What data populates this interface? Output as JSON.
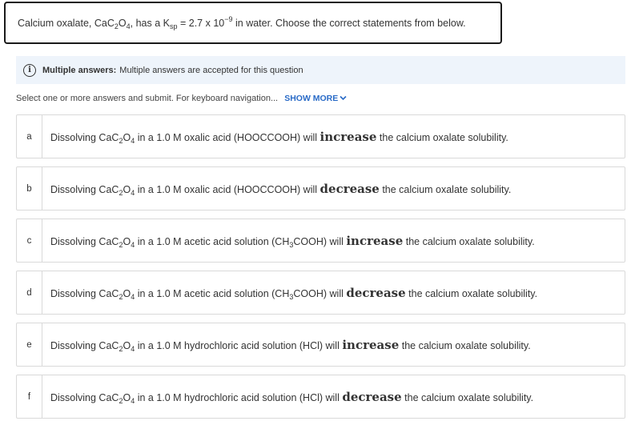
{
  "question": {
    "prefix": "Calcium oxalate, CaC",
    "sub1": "2",
    "mid1": "O",
    "sub2": "4",
    "mid2": ", has a K",
    "sub3": "sp",
    "mid3": " = 2.7 x 10",
    "sup1": "−9",
    "suffix": " in water. Choose the correct statements from below."
  },
  "banner": {
    "icon_name": "info-icon",
    "bold_label": "Multiple answers:",
    "text": "Multiple answers are accepted for this question"
  },
  "instructions": {
    "text": "Select one or more answers and submit. For keyboard navigation...",
    "show_more": "SHOW MORE",
    "chevron_icon": "chevron-down-icon"
  },
  "formula": {
    "a": "Dissolving CaC",
    "s1": "2",
    "b": "O",
    "s2": "4"
  },
  "options": [
    {
      "letter": "a",
      "pre": " in a 1.0 M oxalic acid (HOOCCOOH) will ",
      "keyword": "increase",
      "post": " the calcium oxalate solubility."
    },
    {
      "letter": "b",
      "pre": " in a 1.0 M oxalic acid (HOOCCOOH) will ",
      "keyword": "decrease",
      "post": " the calcium oxalate solubility."
    },
    {
      "letter": "c",
      "pre": " in a 1.0 M acetic acid solution (CH",
      "sub": "3",
      "pre2": "COOH) will ",
      "keyword": "increase",
      "post": " the calcium oxalate solubility."
    },
    {
      "letter": "d",
      "pre": " in a 1.0 M acetic acid solution (CH",
      "sub": "3",
      "pre2": "COOH) will ",
      "keyword": "decrease",
      "post": " the calcium oxalate solubility."
    },
    {
      "letter": "e",
      "pre": " in a 1.0 M hydrochloric acid solution (HCl) will ",
      "keyword": "increase",
      "post": " the calcium oxalate solubility."
    },
    {
      "letter": "f",
      "pre": " in a 1.0 M hydrochloric acid solution (HCl) will ",
      "keyword": "decrease",
      "post": " the calcium oxalate solubility."
    }
  ]
}
